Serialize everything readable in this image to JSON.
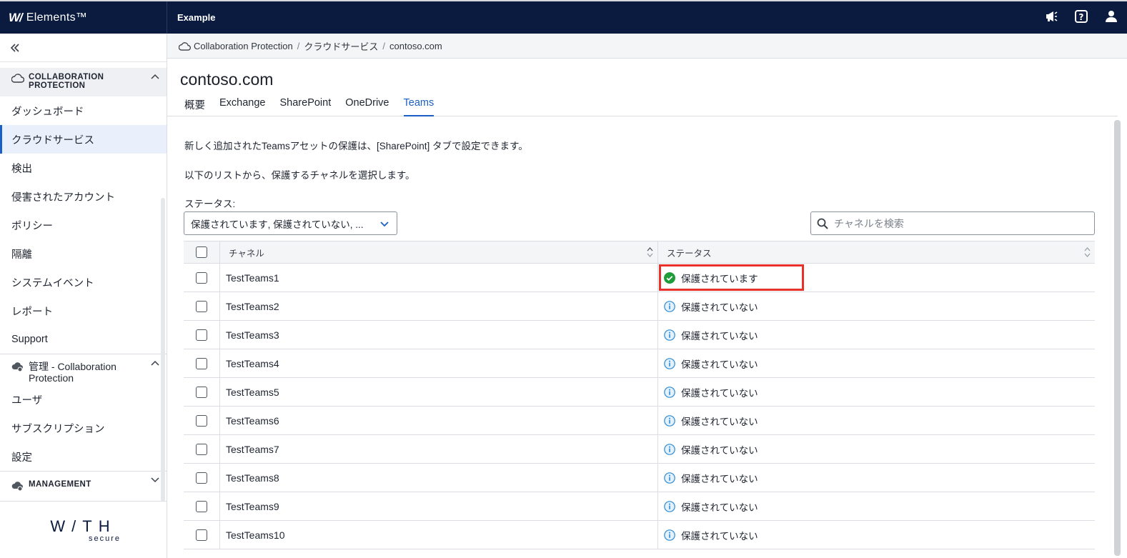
{
  "header": {
    "brand": "Elements™",
    "brand_mark": "W/",
    "app_title": "Example"
  },
  "sidebar": {
    "collab_section": "COLLABORATION PROTECTION",
    "collab_items": [
      "ダッシュボード",
      "クラウドサービス",
      "検出",
      "侵害されたアカウント",
      "ポリシー",
      "隔離",
      "システムイベント",
      "レポート",
      "Support"
    ],
    "admin_section": "管理 - Collaboration Protection",
    "admin_items": [
      "ユーザ",
      "サブスクリプション",
      "設定"
    ],
    "mgmt_section": "MANAGEMENT",
    "logo_main": "W/TH",
    "logo_sub": "secure"
  },
  "breadcrumb": [
    "Collaboration Protection",
    "クラウドサービス",
    "contoso.com"
  ],
  "page": {
    "title": "contoso.com",
    "tabs": [
      "概要",
      "Exchange",
      "SharePoint",
      "OneDrive",
      "Teams"
    ],
    "active_tab": "Teams",
    "info1": "新しく追加されたTeamsアセットの保護は、[SharePoint] タブで設定できます。",
    "info2": "以下のリストから、保護するチャネルを選択します。",
    "status_label": "ステータス:",
    "status_filter_value": "保護されています, 保護されていない, ...",
    "search_placeholder": "チャネルを検索"
  },
  "table": {
    "headers": {
      "channel": "チャネル",
      "status": "ステータス"
    },
    "rows": [
      {
        "name": "TestTeams1",
        "status": "保護されています",
        "state": "protected"
      },
      {
        "name": "TestTeams2",
        "status": "保護されていない",
        "state": "unprotected"
      },
      {
        "name": "TestTeams3",
        "status": "保護されていない",
        "state": "unprotected"
      },
      {
        "name": "TestTeams4",
        "status": "保護されていない",
        "state": "unprotected"
      },
      {
        "name": "TestTeams5",
        "status": "保護されていない",
        "state": "unprotected"
      },
      {
        "name": "TestTeams6",
        "status": "保護されていない",
        "state": "unprotected"
      },
      {
        "name": "TestTeams7",
        "status": "保護されていない",
        "state": "unprotected"
      },
      {
        "name": "TestTeams8",
        "status": "保護されていない",
        "state": "unprotected"
      },
      {
        "name": "TestTeams9",
        "status": "保護されていない",
        "state": "unprotected"
      },
      {
        "name": "TestTeams10",
        "status": "保護されていない",
        "state": "unprotected"
      }
    ]
  },
  "colors": {
    "navy": "#0b1a3f",
    "accent": "#1b5fc6",
    "success": "#1f9d3a",
    "info": "#2a8bd8",
    "highlight": "#e8312b"
  },
  "icons": {
    "protected": "check-circle-icon",
    "unprotected": "info-circle-icon",
    "topbar": [
      "megaphone-icon",
      "help-icon",
      "user-icon"
    ]
  }
}
